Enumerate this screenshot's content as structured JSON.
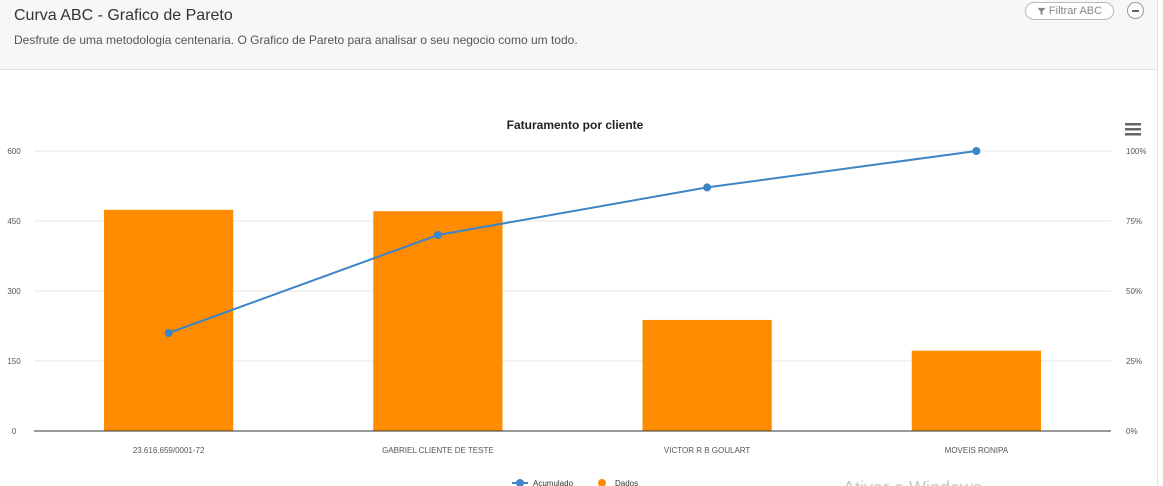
{
  "header": {
    "title": "Curva ABC - Grafico de Pareto",
    "subtitle": "Desfrute de uma metodologia centenaria. O Grafico de Pareto para analisar o seu negocio como um todo.",
    "filter_label": "Filtrar ABC",
    "filter_icon": "filter-icon",
    "collapse_icon": "minus-circle-icon"
  },
  "menu_icon": "hamburger-menu-icon",
  "watermark": "Ativar o Windows",
  "chart_data": {
    "type": "bar",
    "title": "Faturamento por cliente",
    "categories": [
      "23.616.659/0001-72",
      "GABRIEL CLIENTE DE TESTE",
      "VICTOR R B GOULART",
      "MOVEIS RONIPA"
    ],
    "series": [
      {
        "name": "Dados",
        "type": "bar",
        "axis": "left",
        "color": "#ff8c00",
        "values": [
          474,
          471,
          238,
          172
        ]
      },
      {
        "name": "Acumulado",
        "type": "line",
        "axis": "right",
        "color": "#3d85c6",
        "values": [
          35,
          70,
          87,
          100
        ]
      }
    ],
    "y_left": {
      "ticks": [
        "0",
        "150",
        "300",
        "450",
        "600"
      ],
      "ylim": [
        0,
        600
      ]
    },
    "y_right": {
      "ticks": [
        "0%",
        "25%",
        "50%",
        "75%",
        "100%"
      ],
      "ylim": [
        0,
        100
      ]
    },
    "grid": true,
    "legend_placement": "bottom-center"
  }
}
